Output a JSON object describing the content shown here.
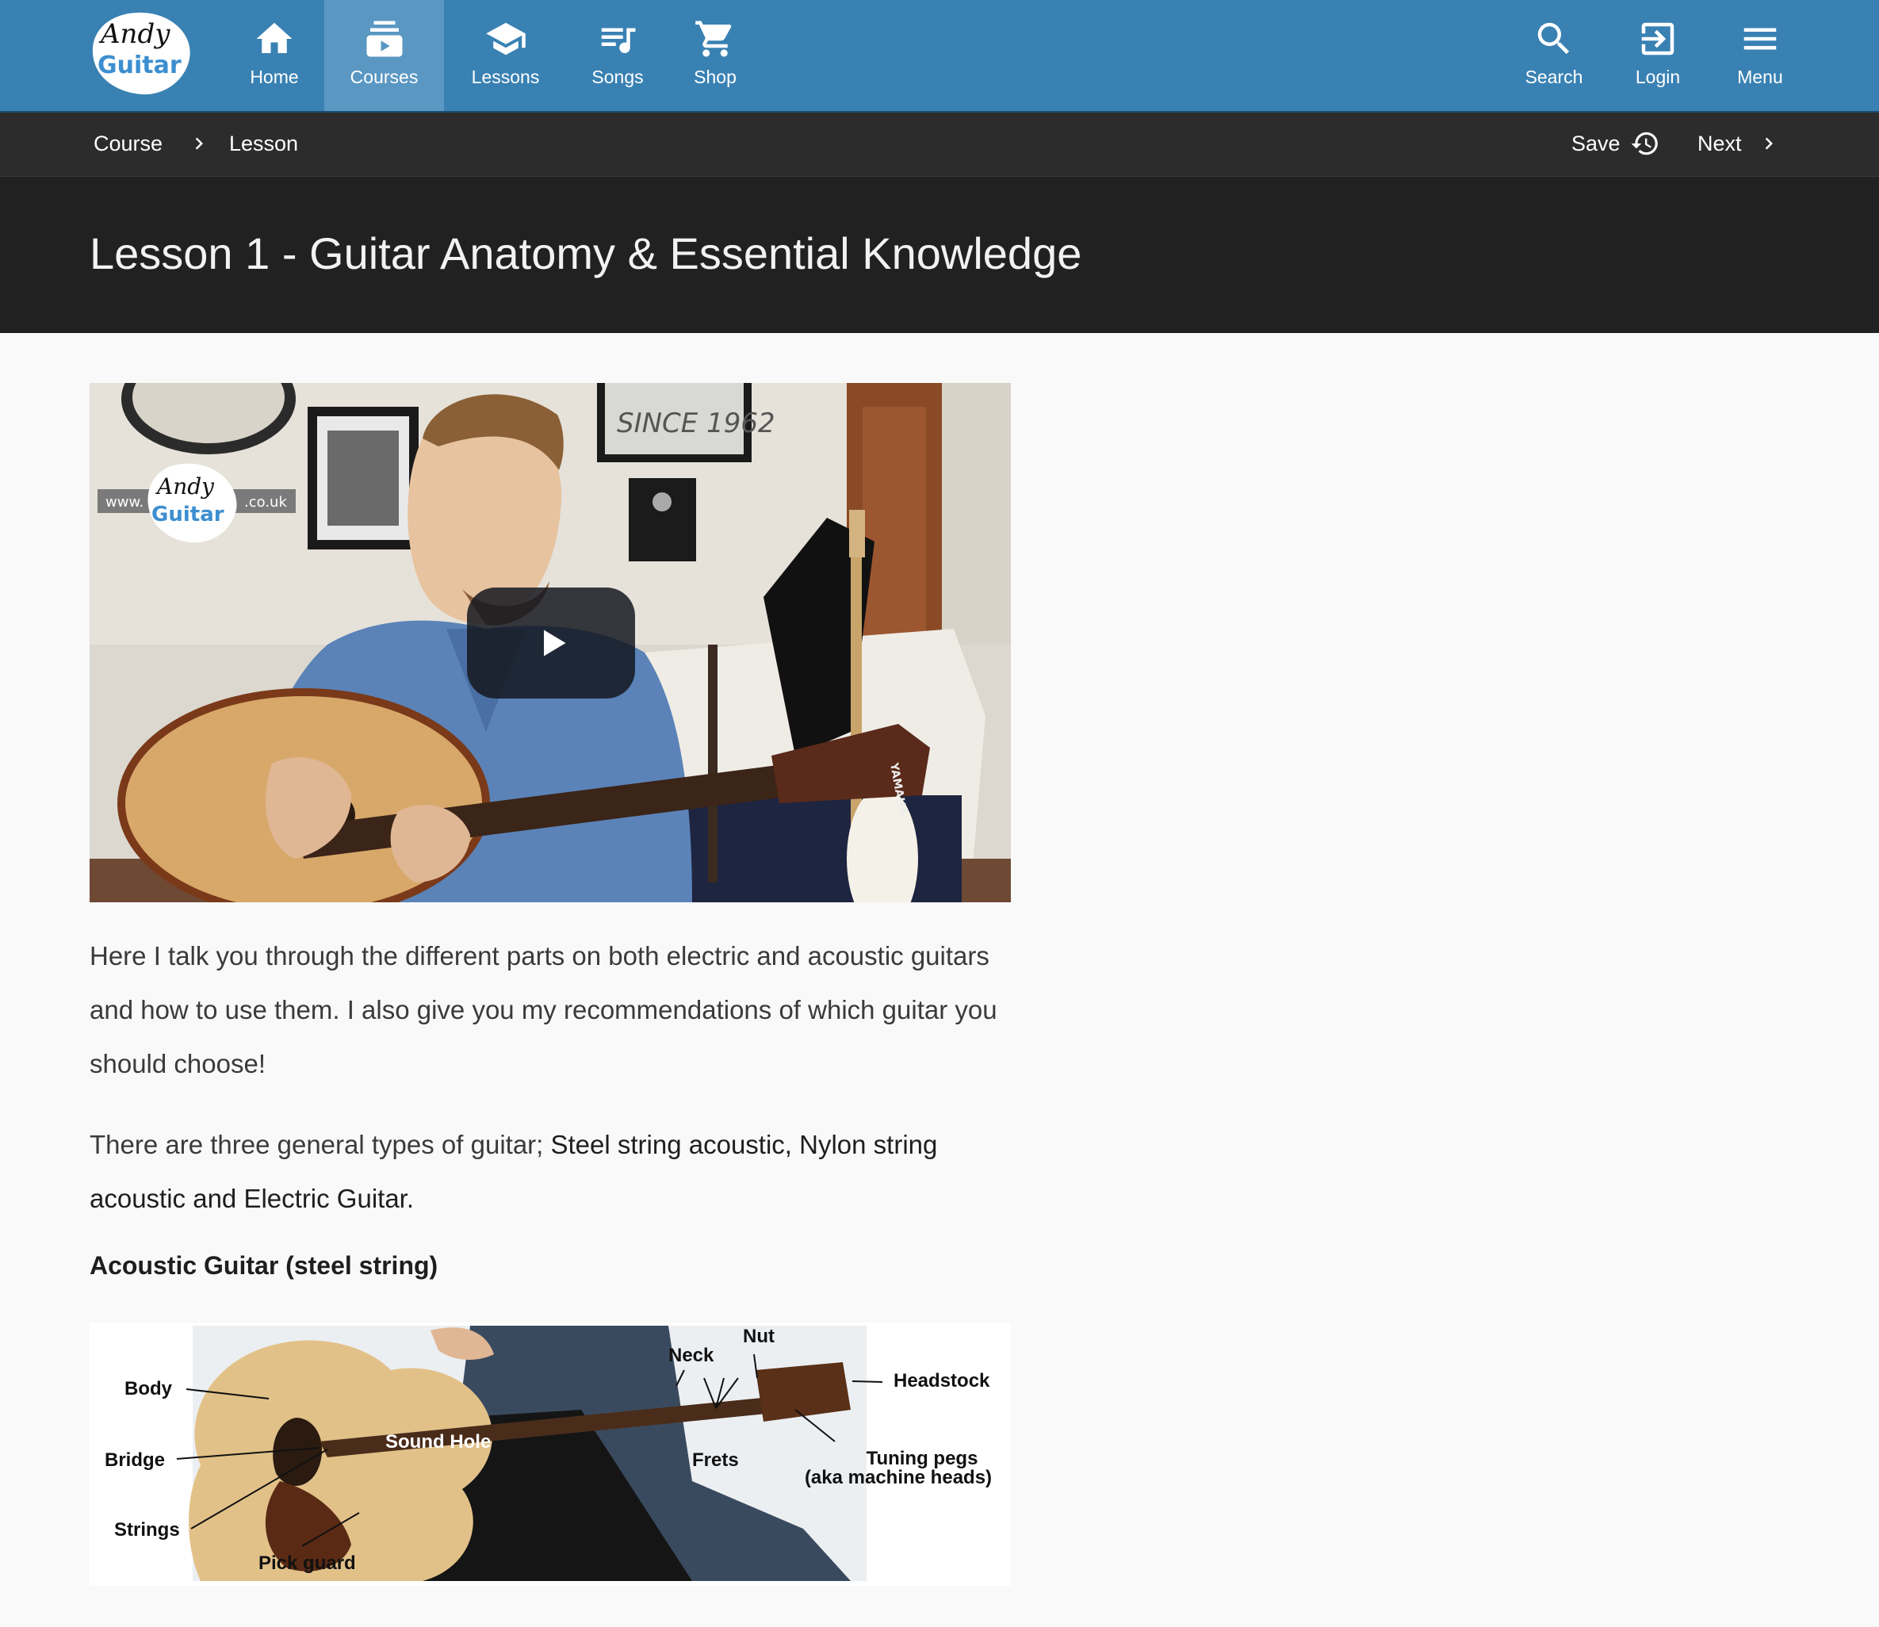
{
  "brand": {
    "logo_text_top": "Andy",
    "logo_text_bottom": "Guitar",
    "nav_color": "#3981b3"
  },
  "nav": {
    "items": [
      {
        "label": "Home",
        "icon": "home-icon"
      },
      {
        "label": "Courses",
        "icon": "courses-icon"
      },
      {
        "label": "Lessons",
        "icon": "lessons-icon"
      },
      {
        "label": "Songs",
        "icon": "songs-icon"
      },
      {
        "label": "Shop",
        "icon": "cart-icon"
      }
    ],
    "active": "Courses",
    "right": [
      {
        "label": "Search",
        "icon": "search-icon"
      },
      {
        "label": "Login",
        "icon": "login-icon"
      },
      {
        "label": "Menu",
        "icon": "menu-icon"
      }
    ]
  },
  "breadcrumb": {
    "course": "Course",
    "lesson": "Lesson",
    "save": "Save",
    "next": "Next"
  },
  "lesson": {
    "title": "Lesson 1 - Guitar Anatomy & Essential Knowledge"
  },
  "video": {
    "watermark_left": "www.",
    "watermark_right": ".co.uk",
    "logo_top": "Andy",
    "logo_bottom": "Guitar",
    "sign_text": "SINCE 1962",
    "headstock_brand": "YAMAHA"
  },
  "content": {
    "para1": "Here I talk you through the different parts on both electric and acoustic guitars and how to use them. I also give you my recommendations of which guitar you should choose!",
    "para2_start": "There are three general types of guitar; ",
    "para2_bold": "Steel string acoustic, Nylon string acoustic and Electric Guitar.",
    "section_heading": "Acoustic Guitar (steel string)"
  },
  "diagram": {
    "body": "Body",
    "bridge": "Bridge",
    "strings": "Strings",
    "pick_guard": "Pick guard",
    "sound_hole": "Sound Hole",
    "neck": "Neck",
    "nut": "Nut",
    "frets": "Frets",
    "headstock": "Headstock",
    "tuning_pegs": "Tuning pegs",
    "machine_heads": "(aka machine heads)"
  }
}
